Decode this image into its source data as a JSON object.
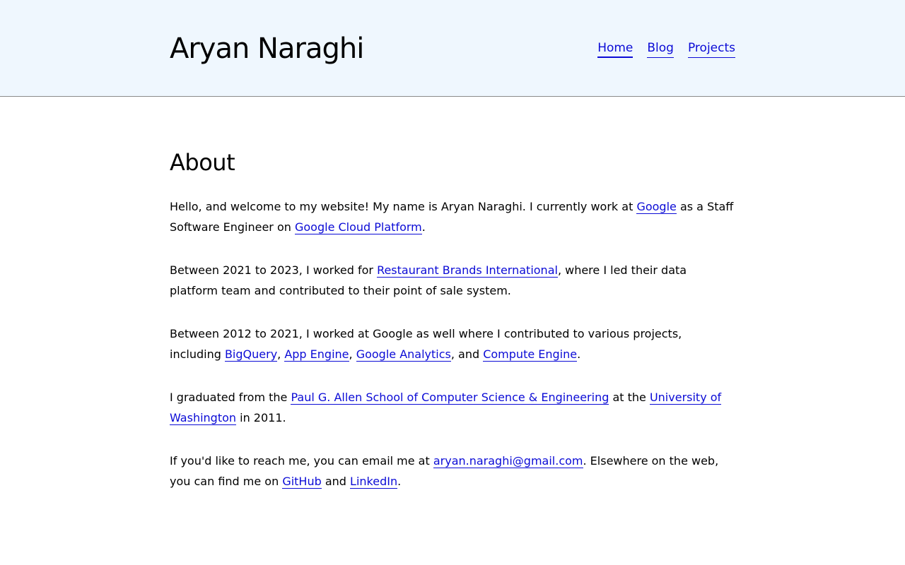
{
  "header": {
    "title": "Aryan Naraghi",
    "nav": [
      "Home",
      "Blog",
      "Projects"
    ]
  },
  "main": {
    "heading": "About",
    "p1": {
      "t1": "Hello, and welcome to my website! My name is Aryan Naraghi. I currently work at ",
      "google": "Google",
      "t2": " as a Staff Software Engineer on ",
      "gcp": "Google Cloud Platform",
      "t3": "."
    },
    "p2": {
      "t1": "Between 2021 to 2023, I worked for ",
      "rbi": "Restaurant Brands International",
      "t2": ", where I led their data platform team and contributed to their point of sale system."
    },
    "p3": {
      "t1": "Between 2012 to 2021, I worked at Google as well where I contributed to various projects, including ",
      "bigquery": "BigQuery",
      "sep1": ", ",
      "appengine": "App Engine",
      "sep2": ", ",
      "analytics": "Google Analytics",
      "sep3": ", and ",
      "compute": "Compute Engine",
      "t2": "."
    },
    "p4": {
      "t1": "I graduated from the ",
      "allen": "Paul G. Allen School of Computer Science & Engineering",
      "t2": " at the ",
      "uw": "University of Washington",
      "t3": " in 2011."
    },
    "p5": {
      "t1": "If you'd like to reach me, you can email me at ",
      "email": "aryan.naraghi@gmail.com",
      "t2": ". Elsewhere on the web, you can find me on ",
      "github": "GitHub",
      "t3": " and ",
      "linkedin": "LinkedIn",
      "t4": "."
    }
  },
  "colors": {
    "header_bg": "#eff7fe",
    "link": "#0b0bd6",
    "text": "#000000"
  }
}
